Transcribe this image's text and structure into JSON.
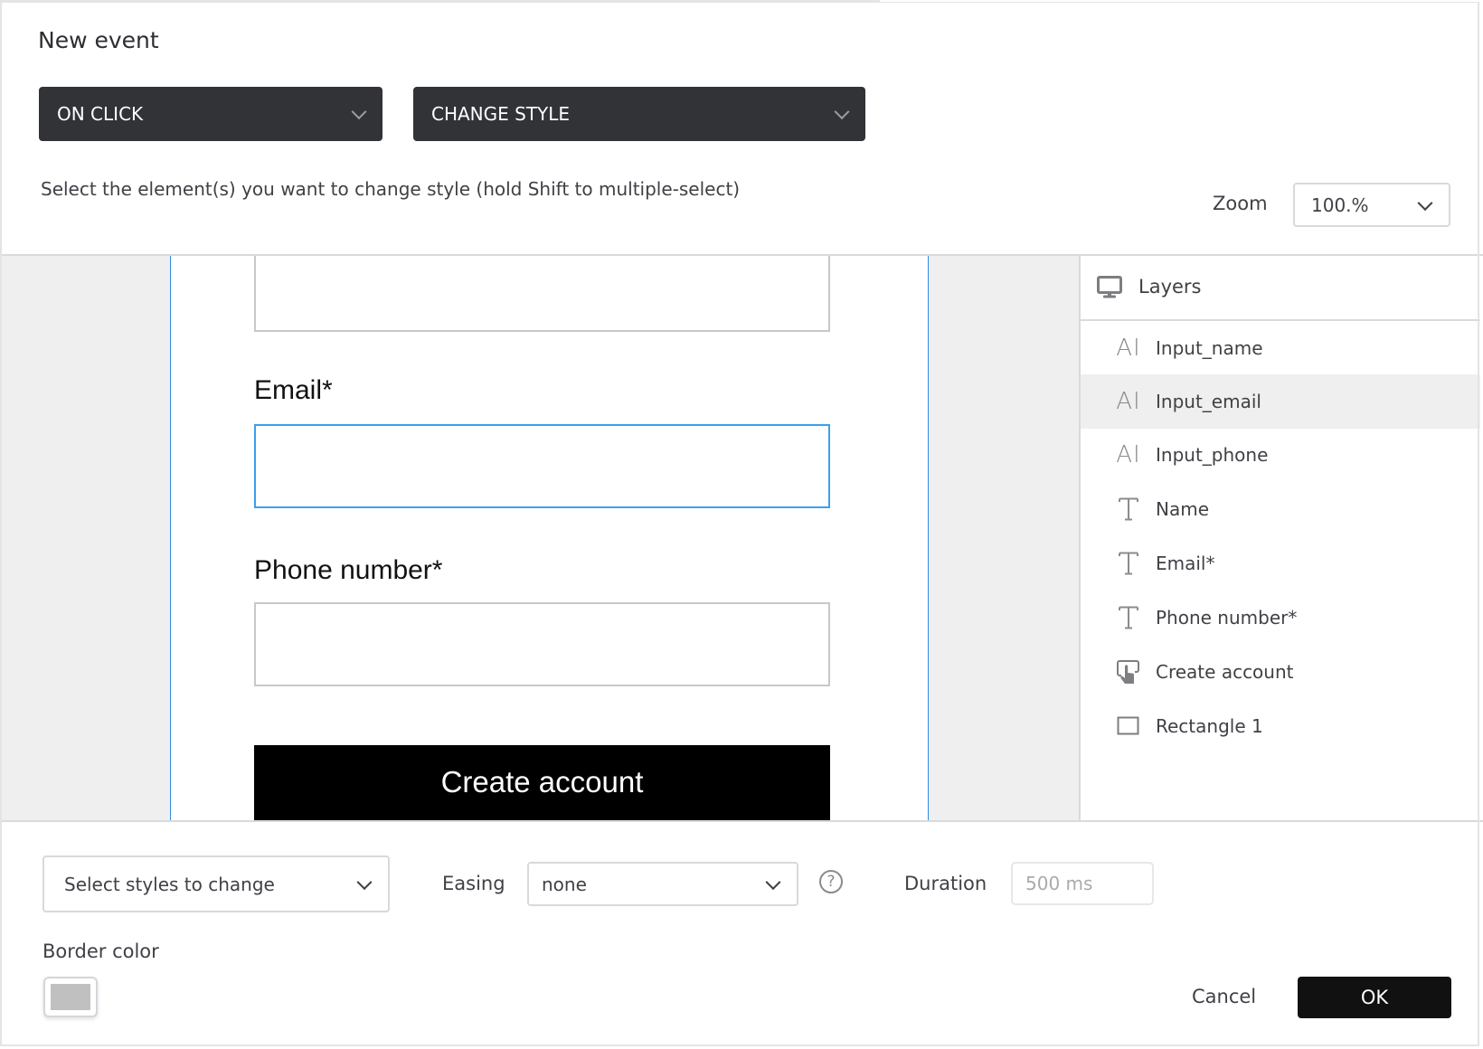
{
  "dialog": {
    "title": "New event",
    "trigger_dropdown": {
      "value": "ON CLICK"
    },
    "action_dropdown": {
      "value": "CHANGE STYLE"
    },
    "instruction": "Select the element(s) you want to change style (hold Shift to multiple-select)",
    "zoom": {
      "label": "Zoom",
      "value": "100.%"
    }
  },
  "canvas": {
    "labels": {
      "email": "Email*",
      "phone": "Phone number*"
    },
    "button_label": "Create account",
    "selected_input": "Input_email",
    "colors": {
      "selection": "#3aa0ef",
      "artboard_border": "#2d8ee0"
    }
  },
  "layers": {
    "title": "Layers",
    "header_icon": "monitor-icon",
    "items": [
      {
        "label": "Input_name",
        "icon": "input-icon",
        "active": false
      },
      {
        "label": "Input_email",
        "icon": "input-icon",
        "active": true
      },
      {
        "label": "Input_phone",
        "icon": "input-icon",
        "active": false
      },
      {
        "label": "Name",
        "icon": "text-icon",
        "active": false
      },
      {
        "label": "Email*",
        "icon": "text-icon",
        "active": false
      },
      {
        "label": "Phone number*",
        "icon": "text-icon",
        "active": false
      },
      {
        "label": "Create account",
        "icon": "button-icon",
        "active": false
      },
      {
        "label": "Rectangle 1",
        "icon": "rectangle-icon",
        "active": false
      }
    ]
  },
  "options": {
    "styles_select": {
      "value": "Select styles to change"
    },
    "easing": {
      "label": "Easing",
      "value": "none"
    },
    "help_icon": "?",
    "duration": {
      "label": "Duration",
      "placeholder": "500 ms"
    },
    "border_color": {
      "label": "Border color",
      "value": "#c0c0c0"
    }
  },
  "footer": {
    "cancel_label": "Cancel",
    "ok_label": "OK"
  }
}
